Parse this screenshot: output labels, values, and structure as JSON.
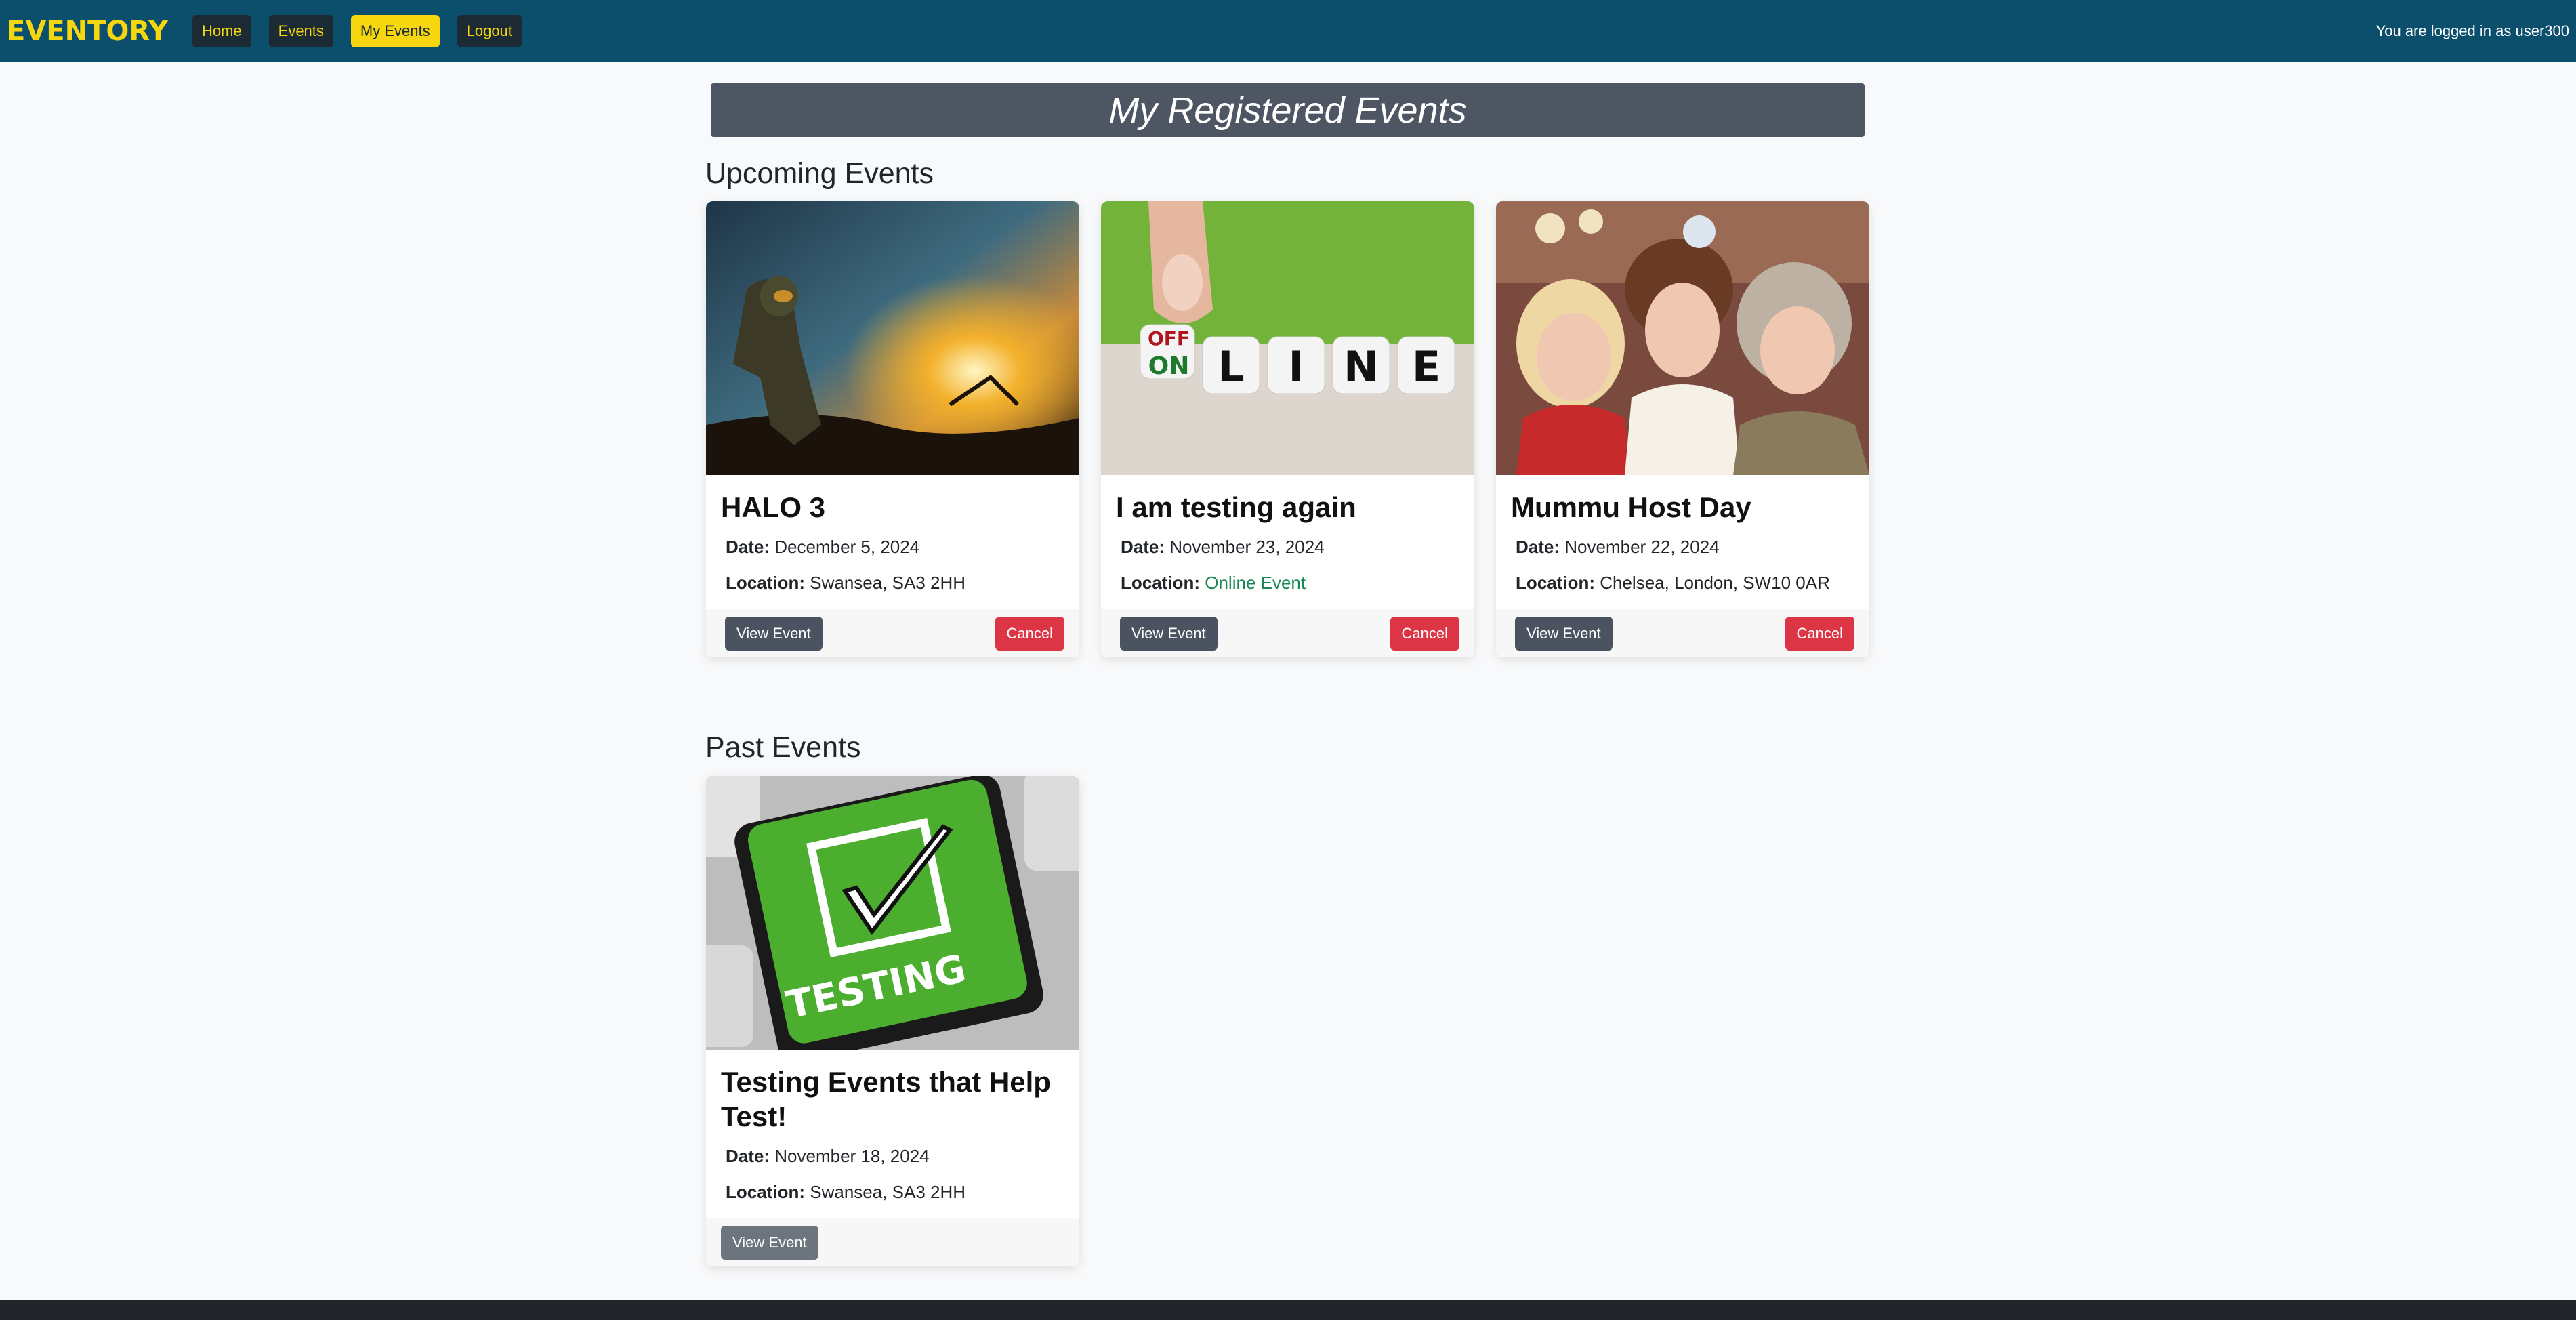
{
  "nav": {
    "brand": "EVENTORY",
    "links": [
      "Home",
      "Events",
      "My Events",
      "Logout"
    ],
    "active": "My Events",
    "login_status": "You are logged in as user300"
  },
  "page": {
    "title": "My Registered Events"
  },
  "upcoming": {
    "heading": "Upcoming Events",
    "events": [
      {
        "title": "HALO 3",
        "date_label": "Date:",
        "date": "December 5, 2024",
        "location_label": "Location:",
        "location": "Swansea, SA3 2HH",
        "image_icon": "halo-soldier-sunset-image",
        "view_label": "View Event",
        "cancel_label": "Cancel"
      },
      {
        "title": "I am testing again",
        "date_label": "Date:",
        "date": "November 23, 2024",
        "location_label": "Location:",
        "location": "Online Event",
        "image_icon": "online-dice-image",
        "view_label": "View Event",
        "cancel_label": "Cancel"
      },
      {
        "title": "Mummu Host Day",
        "date_label": "Date:",
        "date": "November 22, 2024",
        "location_label": "Location:",
        "location": "Chelsea, London, SW10 0AR",
        "image_icon": "three-women-photo-image",
        "view_label": "View Event",
        "cancel_label": "Cancel"
      }
    ]
  },
  "past": {
    "heading": "Past Events",
    "events": [
      {
        "title": "Testing Events that Help Test!",
        "date_label": "Date:",
        "date": "November 18, 2024",
        "location_label": "Location:",
        "location": "Swansea, SA3 2HH",
        "image_icon": "testing-key-checkmark-image",
        "view_label": "View Event"
      }
    ]
  },
  "dice": {
    "off": "OFF",
    "on": "ON",
    "letters": [
      "L",
      "I",
      "N",
      "E"
    ]
  },
  "key_text": "TESTING",
  "colors": {
    "navbar": "#0b4f6c",
    "brand": "#f5d60f",
    "title_bar": "#4e5663",
    "view_button": "#4b5360",
    "cancel_button": "#dc3545",
    "online_text": "#198754"
  }
}
